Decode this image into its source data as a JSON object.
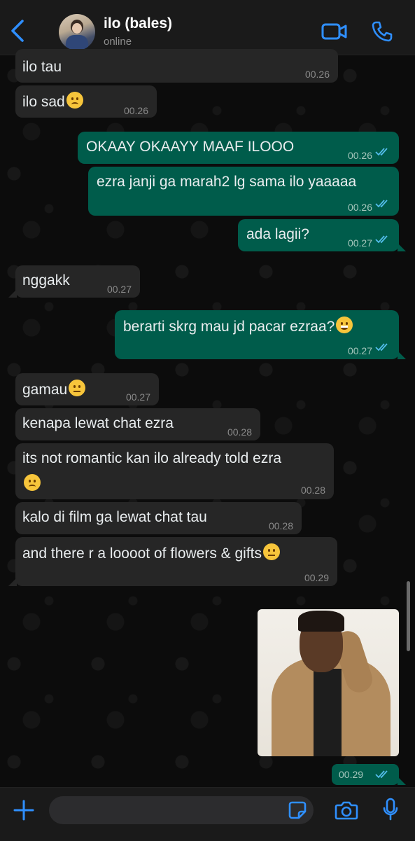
{
  "header": {
    "name": "ilo (bales)",
    "status": "online"
  },
  "messages": [
    {
      "dir": "in",
      "text": "ilo tau",
      "time": "00.26"
    },
    {
      "dir": "in",
      "text": "ilo sad",
      "time": "00.26"
    },
    {
      "dir": "out",
      "text": "OKAAY OKAAYY MAAF ILOOO",
      "time": "00.26"
    },
    {
      "dir": "out",
      "text": "ezra janji ga marah2 lg sama ilo yaaaaa",
      "time": "00.26"
    },
    {
      "dir": "out",
      "text": "ada lagii?",
      "time": "00.27"
    },
    {
      "dir": "in",
      "text": "nggakk",
      "time": "00.27"
    },
    {
      "dir": "out",
      "text": "berarti skrg mau jd pacar ezraa?",
      "time": "00.27"
    },
    {
      "dir": "in",
      "text": "gamau",
      "time": "00.27"
    },
    {
      "dir": "in",
      "text": "kenapa lewat chat ezra",
      "time": "00.28"
    },
    {
      "dir": "in",
      "text": "its not romantic kan ilo already told ezra",
      "time": "00.28"
    },
    {
      "dir": "in",
      "text": "kalo di film ga lewat chat tau",
      "time": "00.28"
    },
    {
      "dir": "in",
      "text": "and there r a loooot of flowers & gifts",
      "time": "00.29"
    },
    {
      "dir": "out",
      "type": "image",
      "time": "00.29"
    }
  ],
  "colors": {
    "accent": "#2f8fff",
    "outgoing_bubble": "#005c4b",
    "incoming_bubble": "#262626",
    "read_ticks": "#53bdeb"
  },
  "icons": [
    "back-chevron-icon",
    "video-call-icon",
    "phone-call-icon",
    "plus-icon",
    "sticker-icon",
    "camera-icon",
    "microphone-icon"
  ]
}
